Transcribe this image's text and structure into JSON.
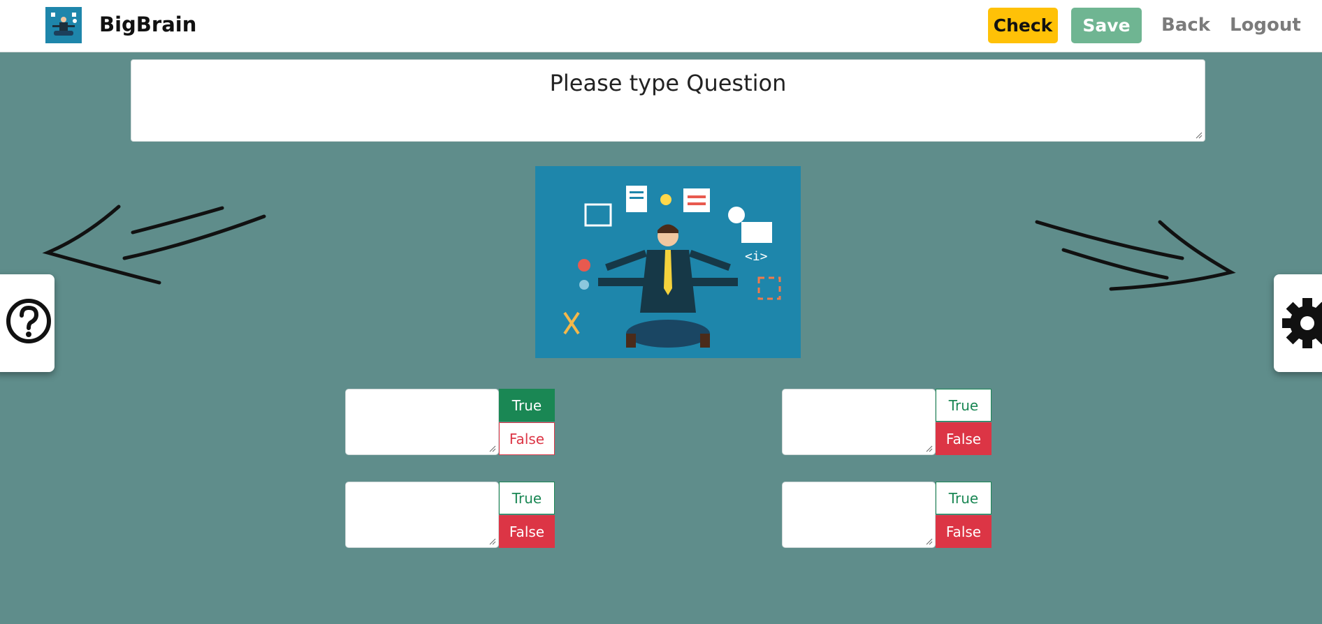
{
  "navbar": {
    "brand": "BigBrain",
    "check_label": "Check",
    "save_label": "Save",
    "back_label": "Back",
    "logout_label": "Logout"
  },
  "question": {
    "placeholder": "Please type Question"
  },
  "answers": [
    {
      "value": "",
      "true_label": "True",
      "false_label": "False",
      "selected": "true"
    },
    {
      "value": "",
      "true_label": "True",
      "false_label": "False",
      "selected": "false"
    },
    {
      "value": "",
      "true_label": "True",
      "false_label": "False",
      "selected": "false"
    },
    {
      "value": "",
      "true_label": "True",
      "false_label": "False",
      "selected": "false"
    }
  ],
  "icons": {
    "help": "help-circle-icon",
    "settings": "gear-icon",
    "prev": "arrow-left-icon",
    "next": "arrow-right-icon"
  },
  "colors": {
    "background": "#5f8d8b",
    "check": "#ffc107",
    "save": "#6fb592",
    "true": "#1a8754",
    "false": "#dc3545"
  }
}
